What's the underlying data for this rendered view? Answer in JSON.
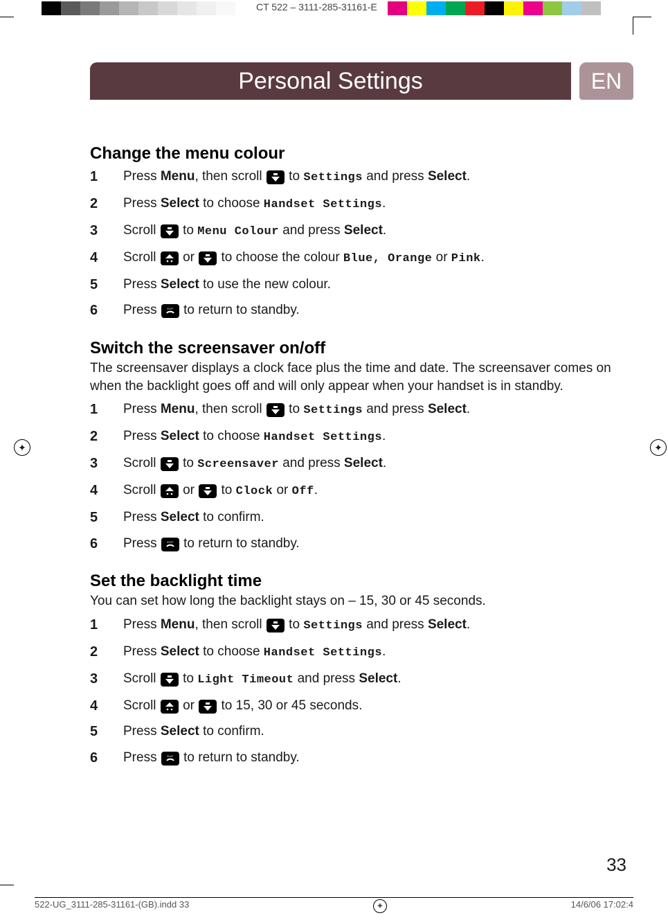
{
  "print_header": {
    "code": "CT 522  –   3111-285-31161-E"
  },
  "title_bar": {
    "title": "Personal Settings",
    "lang": "EN"
  },
  "sections": [
    {
      "heading": "Change the menu colour",
      "intro": "",
      "steps": [
        {
          "pre": "Press ",
          "bold1": "Menu",
          "mid1": ", then scroll ",
          "icon1": "down",
          "mid2": " to ",
          "ui": "Settings",
          "post": " and press ",
          "bold2": "Select",
          "tail": "."
        },
        {
          "pre": "Press ",
          "bold1": "Select",
          "mid1": " to choose ",
          "ui": "Handset Settings",
          "tail": "."
        },
        {
          "pre": "Scroll ",
          "icon1": "down",
          "mid1": " to ",
          "ui": "Menu Colour",
          "post": " and press ",
          "bold2": "Select",
          "tail": "."
        },
        {
          "pre": "Scroll ",
          "icon1": "up",
          "mid1": " or ",
          "icon2": "down",
          "mid2": " to choose the colour ",
          "ui": "Blue, Orange",
          "post": " or ",
          "ui2": "Pink",
          "tail": "."
        },
        {
          "pre": "Press ",
          "bold1": "Select",
          "mid1": " to use the new colour."
        },
        {
          "pre": "Press ",
          "icon1": "exit",
          "mid1": " to return to standby."
        }
      ]
    },
    {
      "heading": "Switch the screensaver on/off",
      "intro": "The screensaver displays a clock face plus the time and date. The screensaver comes on when the backlight goes off and will only appear when your handset is in standby.",
      "steps": [
        {
          "pre": "Press ",
          "bold1": "Menu",
          "mid1": ", then scroll ",
          "icon1": "down",
          "mid2": " to ",
          "ui": "Settings",
          "post": " and press ",
          "bold2": "Select",
          "tail": "."
        },
        {
          "pre": "Press ",
          "bold1": "Select",
          "mid1": " to choose ",
          "ui": "Handset Settings",
          "tail": "."
        },
        {
          "pre": "Scroll ",
          "icon1": "down",
          "mid1": " to ",
          "ui": "Screensaver",
          "post": " and press ",
          "bold2": "Select",
          "tail": "."
        },
        {
          "pre": "Scroll ",
          "icon1": "up",
          "mid1": " or ",
          "icon2": "down",
          "mid2": " to ",
          "ui": "Clock",
          "post": " or ",
          "ui2": "Off",
          "tail": "."
        },
        {
          "pre": "Press ",
          "bold1": "Select",
          "mid1": " to confirm."
        },
        {
          "pre": "Press ",
          "icon1": "exit",
          "mid1": " to return to standby."
        }
      ]
    },
    {
      "heading": "Set the backlight time",
      "intro": "You can set how long the backlight stays on – 15, 30 or 45 seconds.",
      "steps": [
        {
          "pre": "Press ",
          "bold1": "Menu",
          "mid1": ", then scroll ",
          "icon1": "down",
          "mid2": " to ",
          "ui": "Settings",
          "post": " and press ",
          "bold2": "Select",
          "tail": "."
        },
        {
          "pre": "Press ",
          "bold1": "Select",
          "mid1": " to choose ",
          "ui": "Handset Settings",
          "tail": "."
        },
        {
          "pre": "Scroll ",
          "icon1": "down",
          "mid1": " to ",
          "ui": "Light Timeout",
          "post": " and press ",
          "bold2": "Select",
          "tail": "."
        },
        {
          "pre": "Scroll ",
          "icon1": "up",
          "mid1": " or ",
          "icon2": "down",
          "mid2": " to 15, 30 or 45 seconds."
        },
        {
          "pre": "Press ",
          "bold1": "Select",
          "mid1": " to confirm."
        },
        {
          "pre": "Press ",
          "icon1": "exit",
          "mid1": " to return to standby."
        }
      ]
    }
  ],
  "page_number": "33",
  "footer": {
    "left": "522-UG_3111-285-31161-(GB).indd   33",
    "right": "14/6/06   17:02:4"
  },
  "colors": {
    "bar1": [
      "#000000",
      "#5a5a5a",
      "#7a7a7a",
      "#9a9a9a",
      "#b5b5b5",
      "#c8c8c8",
      "#d8d8d8",
      "#e6e6e6",
      "#f0f0f0",
      "#f8f8f8",
      "#ffffff"
    ],
    "bar2": [
      "#e4007f",
      "#ffff00",
      "#00aeef",
      "#00a651",
      "#ed1c24",
      "#000000",
      "#fff200",
      "#ec008c",
      "#8dc63f",
      "#a0cde8",
      "#c0c0c0"
    ]
  }
}
